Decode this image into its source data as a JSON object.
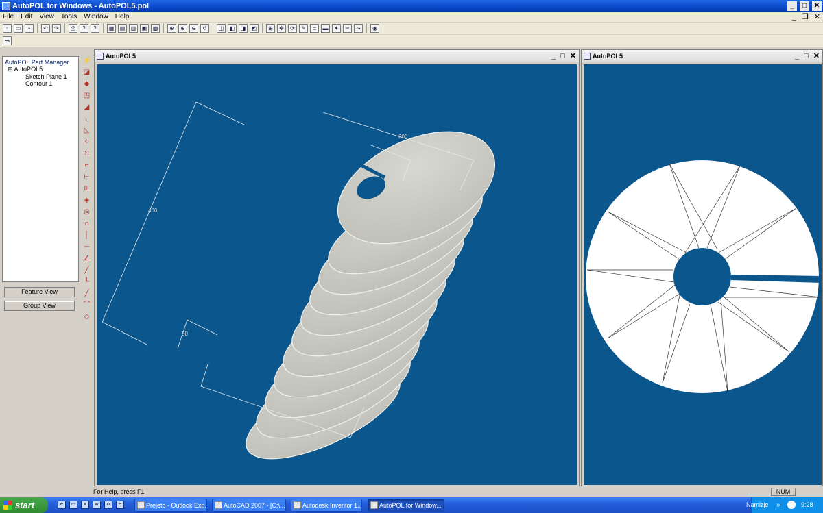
{
  "window": {
    "title": "AutoPOL for Windows - AutoPOL5.pol"
  },
  "menu": {
    "items": [
      "File",
      "Edit",
      "View",
      "Tools",
      "Window",
      "Help"
    ]
  },
  "manager": {
    "header": "AutoPOL Part Manager",
    "root": "AutoPOL5",
    "children": [
      "Sketch Plane 1",
      "Contour 1"
    ]
  },
  "buttons": {
    "feature_view": "Feature View",
    "group_view": "Group View"
  },
  "views": {
    "left": {
      "title": "AutoPOL5",
      "dims": {
        "d200": "200",
        "d50a": "50",
        "d400": "400",
        "d50b": "50"
      }
    },
    "right": {
      "title": "AutoPOL5"
    }
  },
  "status": {
    "help": "For Help, press F1",
    "num": "NUM"
  },
  "taskbar": {
    "start": "start",
    "tasks": [
      "Prejeto - Outlook Exp...",
      "AutoCAD 2007 - [C:\\...",
      "Autodesk Inventor 1...",
      "AutoPOL for Window..."
    ],
    "lang": "Namizje",
    "clock": "9:28"
  },
  "colors": {
    "viewport": "#0b568c",
    "titlebar": "#0a46c8"
  }
}
